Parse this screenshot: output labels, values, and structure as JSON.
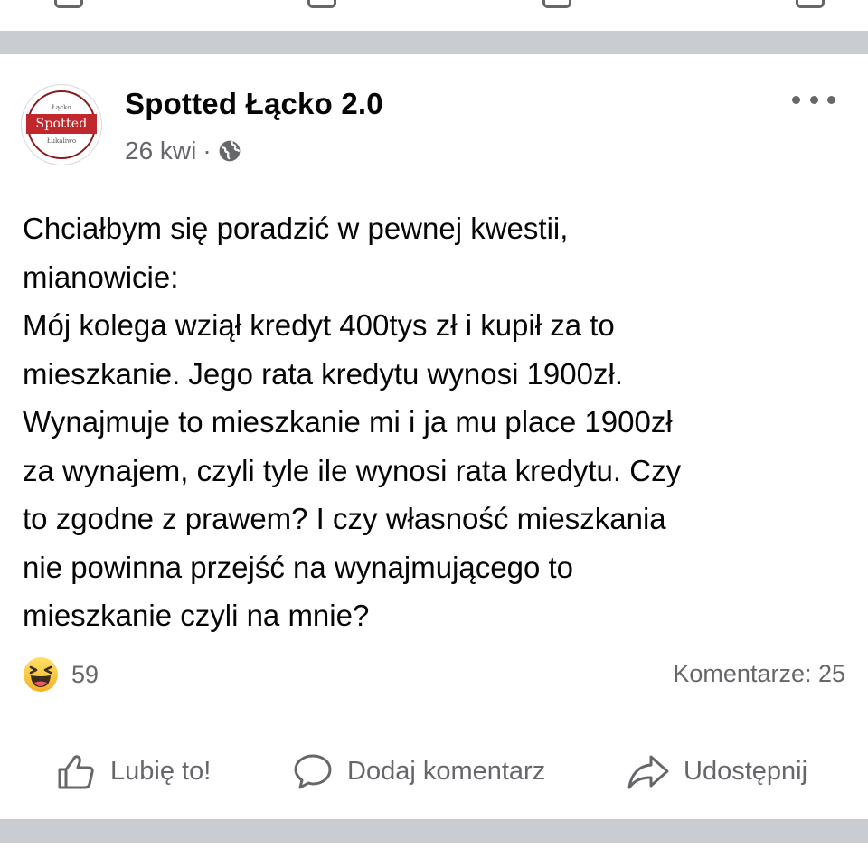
{
  "post": {
    "page_name": "Spotted Łącko 2.0",
    "date": "26 kwi",
    "separator": "·",
    "privacy_icon": "globe-icon",
    "avatar": {
      "top_text": "Łącko",
      "banner_text": "Spotted",
      "bottom_text": "Łukaliwo",
      "accent_color": "#c0282c"
    },
    "body_lines": [
      "Chciałbym się poradzić w pewnej kwestii,",
      "mianowicie:",
      "Mój kolega wziął kredyt 400tys zł i kupił za to",
      "mieszkanie. Jego rata kredytu wynosi 1900zł.",
      "Wynajmuje to mieszkanie mi i ja mu place 1900zł",
      "za wynajem, czyli tyle ile wynosi rata kredytu. Czy",
      "to zgodne z prawem? I czy własność mieszkania",
      "nie powinna przejść na wynajmującego to",
      "mieszkanie czyli na mnie?"
    ],
    "reaction_icon": "haha-icon",
    "reaction_count": "59",
    "comments_label": "Komentarze: 25"
  },
  "actions": {
    "like_label": "Lubię to!",
    "comment_label": "Dodaj komentarz",
    "share_label": "Udostępnij"
  },
  "colors": {
    "divider": "#c9ccd1",
    "secondary_text": "#65676b",
    "primary_text": "#050505"
  }
}
